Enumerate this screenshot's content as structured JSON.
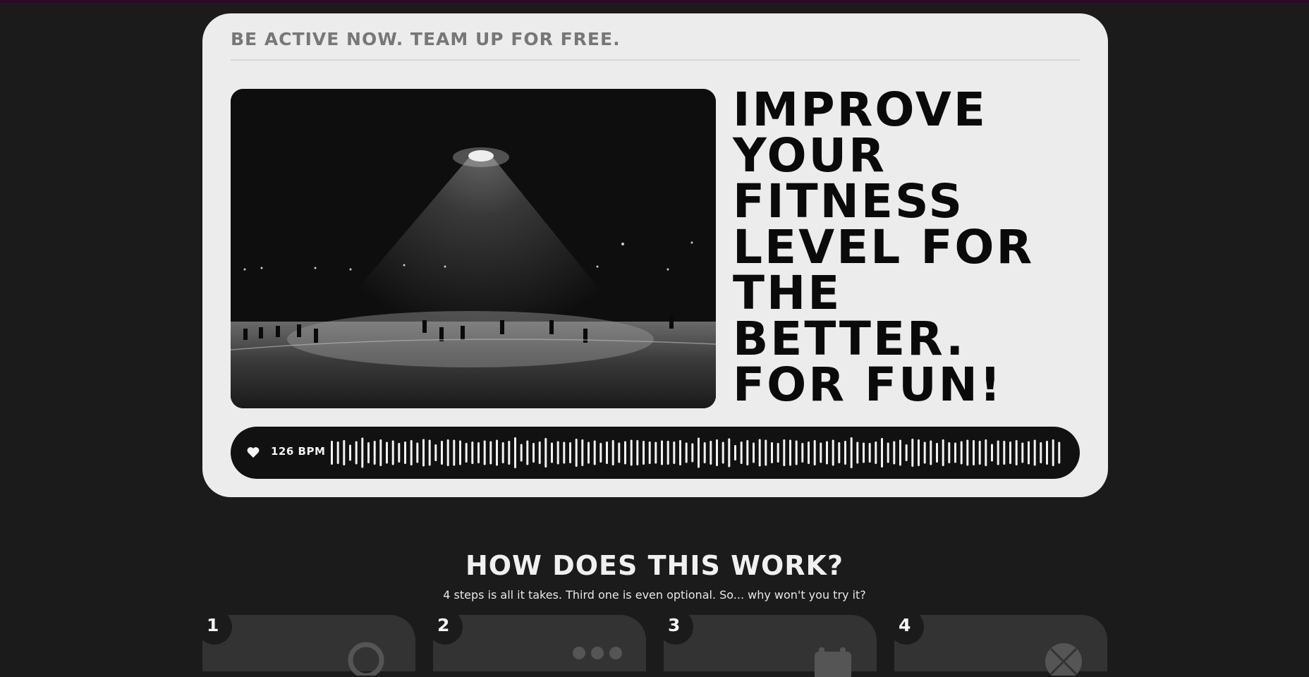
{
  "hero": {
    "tagline": "BE ACTIVE NOW. TEAM UP FOR FREE.",
    "headline": "IMPROVE YOUR FITNESS LEVEL FOR THE BETTER. FOR FUN!",
    "photo_icon": "night-football-field-photo",
    "heart_icon": "heart-icon",
    "bpm_label": "126 BPM"
  },
  "how": {
    "title": "HOW DOES THIS WORK?",
    "subtitle": "4 steps is all it takes. Third one is even optional. So... why won't you try it?",
    "steps": [
      {
        "number": "1",
        "icon": "search-icon"
      },
      {
        "number": "2",
        "icon": "more-dots-icon"
      },
      {
        "number": "3",
        "icon": "calendar-icon"
      },
      {
        "number": "4",
        "icon": "basketball-icon"
      }
    ]
  },
  "colors": {
    "page_bg": "#1b1b1b",
    "card_bg": "#ececec",
    "bpm_bar_bg": "#111111",
    "step_card_bg": "#333333",
    "accent_top": "#2a0a26"
  }
}
